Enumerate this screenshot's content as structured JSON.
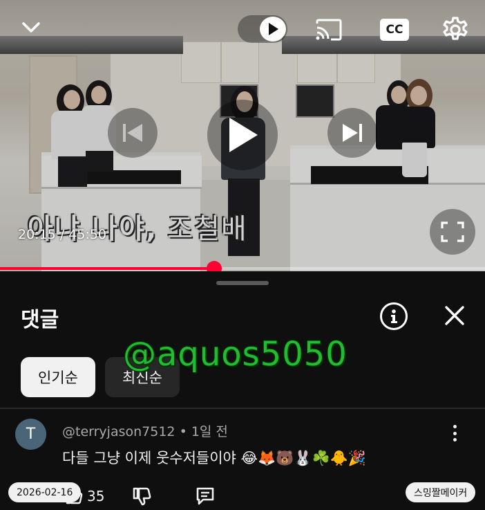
{
  "player": {
    "subtitle_part1": "아냐 나야,",
    "subtitle_part2": "조철배",
    "time_current": "20:15",
    "time_separator": "/",
    "time_total": "45:50",
    "progress_fraction": 0.4418,
    "cc_label": "CC",
    "icons": {
      "collapse": "chevron-down-icon",
      "autoplay": "autoplay-toggle-icon",
      "cast": "cast-icon",
      "settings": "gear-icon",
      "previous": "skip-previous-icon",
      "play": "play-icon",
      "next": "skip-next-icon",
      "fullscreen": "fullscreen-icon"
    },
    "colors": {
      "progress": "#ff0033"
    }
  },
  "comments_panel": {
    "title": "댓글",
    "watermark": "@aquos5050",
    "sort_chips": [
      {
        "label": "인기순",
        "active": true
      },
      {
        "label": "최신순",
        "active": false
      }
    ],
    "comments": [
      {
        "avatar_letter": "T",
        "author": "@terryjason7512",
        "separator": "•",
        "time_ago": "1일 전",
        "text": "다들 그냥 이제 웃수저들이야 😂🦊🐻🐰☘️🐥🎉",
        "like_count": "35"
      }
    ],
    "badges": {
      "date": "2026-02-16",
      "creator": "스밍짤메이커"
    },
    "colors": {
      "watermark": "#22bb33",
      "avatar": "#4a6478"
    }
  }
}
